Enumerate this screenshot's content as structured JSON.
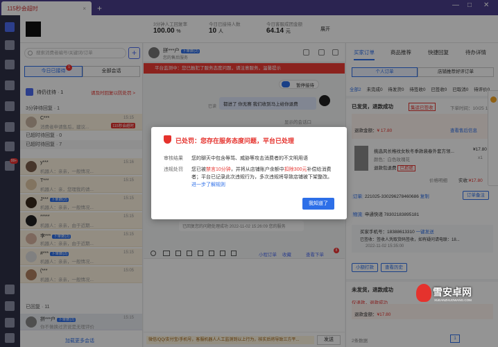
{
  "window": {
    "tab_label": "115秒会超时",
    "tab_close": "×",
    "new_tab": "+",
    "minimize": "—",
    "maximize": "□",
    "close": "✕"
  },
  "rail": {
    "badge_top": "",
    "badge_bottom": "99+"
  },
  "header": {
    "stats": [
      {
        "label": "3分钟人工回复率",
        "value": "100.00",
        "unit": "%"
      },
      {
        "label": "今日已接待人数",
        "value": "10",
        "unit": "人"
      },
      {
        "label": "今日客服成团金额",
        "value": "64.14",
        "unit": "元"
      }
    ],
    "expand": "展开"
  },
  "sessions": {
    "search_placeholder": "搜索消费者编号/关键词/订单",
    "tabs": [
      "今日已接待",
      "全部会话"
    ],
    "tab_badge": "1",
    "pending_title": "待仍往待 · 1",
    "pending_link": "请及时回复以防处罚 >",
    "group1": "3分钟待回复 · 1",
    "urgent": {
      "name": "C***",
      "time": "15:15",
      "msg": "消费者申请售后，建议...",
      "tag": "115秒会超时"
    },
    "group2": "已超时待回复 · 0",
    "group3": "已超时待回复 · 7",
    "items": [
      {
        "name": "y***",
        "time": "15:16",
        "msg": "机器人：亲亲，一般情况..."
      },
      {
        "name": "T***",
        "time": "15:15",
        "msg": "机器人：亲，您理我的请..."
      },
      {
        "name": "J***",
        "time": "15:15",
        "msg": "机器人：亲亲，一般情况...",
        "tag": "下单数(2)"
      },
      {
        "name": "*****",
        "time": "15:15",
        "msg": "机器人：亲亲，由于近期..."
      },
      {
        "name": "李***",
        "time": "15:15",
        "msg": "机器人：亲亲，由于近期...",
        "tag": "下单数(2)"
      },
      {
        "name": "#***",
        "time": "15:15",
        "msg": "机器人：亲亲，一般情况...",
        "tag": "下单数(2)"
      },
      {
        "name": "(***",
        "time": "15:05",
        "msg": "机器人：亲亲，一般情况..."
      }
    ],
    "group4": "已回复 · 11",
    "replied": {
      "name": "拼***户",
      "time": "15:15",
      "msg": "你不做换过货说是无理评价",
      "tag": "下单数(2)"
    },
    "load_more": "加载更多会话"
  },
  "chat": {
    "title": "拼***户",
    "title_tag": "下单数(2)",
    "subtitle": "您的售后服务",
    "warning": "平台监测中：您已触犯了服务态度问题，请注意服务，温馨提示",
    "bot_label": "暂停接待",
    "bubble1": "都进了 你无赛 我们收到马上给你退费",
    "side_time": "已读",
    "sender": "显示的会话口",
    "notice": "已回复您的问题处理成功 2022-11-02 15:26:09  您的服务",
    "tools": [
      "小程订单",
      "收藏",
      "查看下单"
    ],
    "tool_badge": "8",
    "bottom_hint": "微信/QQ/支付宝/手机号，客服机器人人工监测到以上行为，核实后将导致三方平...",
    "send": "发送"
  },
  "modal": {
    "title": "已处罚：您存在服务态度问题，平台已处理",
    "audit_label": "审核结果",
    "audit_text": "您的聊天中包含辱骂、威胁等攻击消费者的不文明用语",
    "penalty_label": "违规处罚",
    "penalty_pre": "您已被",
    "penalty_ban": "禁言10分钟",
    "penalty_mid": "，并将从店铺账户余额中",
    "penalty_fine": "扣除300元",
    "penalty_post": "补偿给消费者；平台已记录此次违规行为，多次违规将导致店铺被下架整改。",
    "penalty_link": "进一步了解规则",
    "button": "我知道了"
  },
  "right": {
    "tabs": [
      "买家订单",
      "商品推荐",
      "快捷回复",
      "待办详情"
    ],
    "subtabs": [
      "个人订单",
      "店铺推荐好评订单"
    ],
    "filters": [
      "全部2",
      "未完成0",
      "待发货0",
      "待签收0",
      "已签收0",
      "已取消0",
      "待评价0"
    ],
    "order1": {
      "status": "已发货，退款成功",
      "status_tag": "集运已签收",
      "time": "下单时间：10/25 16:28",
      "refund_label": "退款金额：",
      "refund_amount": "¥ 17.80",
      "detail_link": "查看售后信息",
      "product": "挑选风长格纹女秋冬季款裴春外套方领...",
      "price": "¥17.80",
      "spec": "颜色：白色玫瑰花",
      "qty": "x1",
      "status_small": "退款包退费",
      "status_badge": "已拒绝",
      "paid_label": "价格明细",
      "paid": "实收:",
      "paid_amount": "¥17.80",
      "order_no_label": "订单",
      "order_no": "221025-330296278460686",
      "copy": "复制",
      "remark": "订单备注",
      "logistics_label": "物流",
      "logistics": "申通快递  78302183895181",
      "address_label": "买家手机号：18388613310",
      "address_link": "一键发送",
      "ship_note": "已签收：签收人凭取货码签收，如有疑问请电联：18...",
      "ship_time": "2022-11-02 15:35:00",
      "btn_small": "小额打款",
      "btn_more": "查看历史"
    },
    "order2": {
      "status": "未发货，退款成功",
      "refund_tag": "仅退款，退款成功",
      "refund_label": "退款金额：",
      "refund_amount": "¥17.80"
    },
    "pager": "2条数据",
    "page_no": "1"
  },
  "watermark": {
    "text": "雪安卓网",
    "sub": "XUEANZHUOWANG.COM"
  }
}
